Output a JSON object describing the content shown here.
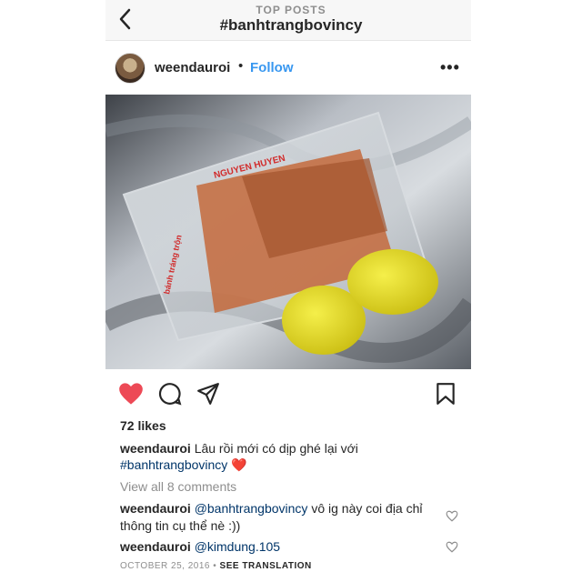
{
  "header": {
    "section": "TOP POSTS",
    "hashtag": "#banhtrangbovincy"
  },
  "post": {
    "username": "weendauroi",
    "separator": "•",
    "follow_label": "Follow",
    "more_label": "•••",
    "likes": "72 likes",
    "caption": {
      "user": "weendauroi",
      "text": "Lâu rồi mới có dịp ghé lại với",
      "hashtag": "#banhtrangbovincy",
      "emoji": "❤️"
    },
    "view_comments": "View all 8 comments",
    "comments": [
      {
        "user": "weendauroi",
        "mention": "@banhtrangbovincy",
        "text": " vô ig này coi địa chỉ thông tin cụ thể nè :))"
      },
      {
        "user": "weendauroi",
        "mention": "@kimdung.105",
        "text": ""
      }
    ],
    "date": "OCTOBER 25, 2016",
    "date_sep": " • ",
    "see_translation": "SEE TRANSLATION",
    "bag_label_1": "NGUYEN HUYEN",
    "bag_label_2": "bánh tráng trộn"
  },
  "colors": {
    "like_red": "#ed4956",
    "link_blue": "#3897f0",
    "mention_navy": "#003569"
  },
  "icons": [
    "back-chevron-icon",
    "more-icon",
    "heart-icon",
    "comment-icon",
    "share-icon",
    "bookmark-icon",
    "small-heart-icon"
  ]
}
